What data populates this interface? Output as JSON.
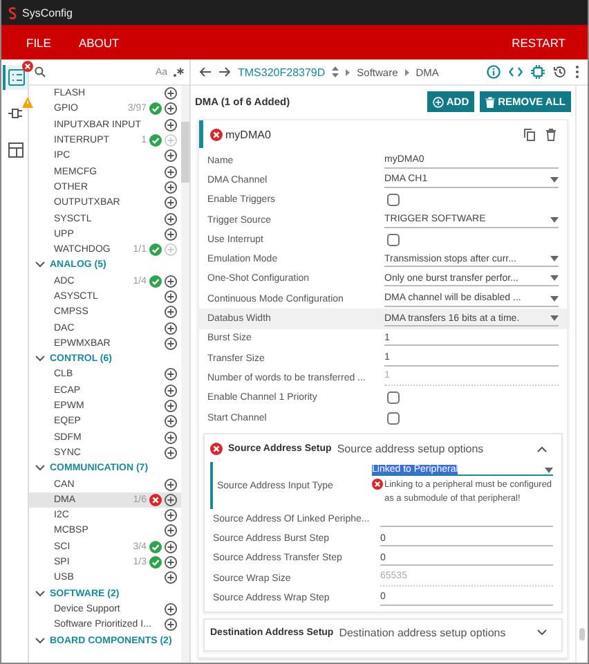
{
  "window": {
    "title": "SysConfig"
  },
  "menu": {
    "items": [
      "FILE",
      "ABOUT"
    ],
    "restart": "RESTART"
  },
  "rail": [
    {
      "kind": "list",
      "error_badge": true,
      "warning_badge": false,
      "selected": true
    },
    {
      "kind": "plug",
      "error_badge": false,
      "warning_badge": true,
      "selected": false
    },
    {
      "kind": "panel",
      "error_badge": false,
      "warning_badge": false,
      "selected": false
    }
  ],
  "sidebar": {
    "case_toggle": "Aa",
    "sections": [
      {
        "items": [
          {
            "label": "FLASH",
            "ok": false,
            "error": false,
            "add_enabled": true,
            "selected": false
          },
          {
            "label": "GPIO",
            "count": "3/97",
            "ok": true,
            "error": false,
            "add_enabled": true,
            "selected": false
          },
          {
            "label": "INPUTXBAR INPUT",
            "ok": false,
            "error": false,
            "add_enabled": true,
            "selected": false
          },
          {
            "label": "INTERRUPT",
            "count": "1",
            "ok": true,
            "error": false,
            "add_enabled": false,
            "selected": false
          },
          {
            "label": "IPC",
            "ok": false,
            "error": false,
            "add_enabled": true,
            "selected": false
          },
          {
            "label": "MEMCFG",
            "ok": false,
            "error": false,
            "add_enabled": true,
            "selected": false
          },
          {
            "label": "OTHER",
            "ok": false,
            "error": false,
            "add_enabled": true,
            "selected": false
          },
          {
            "label": "OUTPUTXBAR",
            "ok": false,
            "error": false,
            "add_enabled": true,
            "selected": false
          },
          {
            "label": "SYSCTL",
            "ok": false,
            "error": false,
            "add_enabled": true,
            "selected": false
          },
          {
            "label": "UPP",
            "ok": false,
            "error": false,
            "add_enabled": true,
            "selected": false
          },
          {
            "label": "WATCHDOG",
            "count": "1/1",
            "ok": true,
            "error": false,
            "add_enabled": false,
            "selected": false
          }
        ]
      },
      {
        "title": "ANALOG (5)",
        "expanded": true,
        "items": [
          {
            "label": "ADC",
            "count": "1/4",
            "ok": true,
            "error": false,
            "add_enabled": true,
            "selected": false
          },
          {
            "label": "ASYSCTL",
            "ok": false,
            "error": false,
            "add_enabled": true,
            "selected": false
          },
          {
            "label": "CMPSS",
            "ok": false,
            "error": false,
            "add_enabled": true,
            "selected": false
          },
          {
            "label": "DAC",
            "ok": false,
            "error": false,
            "add_enabled": true,
            "selected": false
          },
          {
            "label": "EPWMXBAR",
            "ok": false,
            "error": false,
            "add_enabled": true,
            "selected": false
          }
        ]
      },
      {
        "title": "CONTROL (6)",
        "expanded": true,
        "items": [
          {
            "label": "CLB",
            "ok": false,
            "error": false,
            "add_enabled": true,
            "selected": false
          },
          {
            "label": "ECAP",
            "ok": false,
            "error": false,
            "add_enabled": true,
            "selected": false
          },
          {
            "label": "EPWM",
            "ok": false,
            "error": false,
            "add_enabled": true,
            "selected": false
          },
          {
            "label": "EQEP",
            "ok": false,
            "error": false,
            "add_enabled": true,
            "selected": false
          },
          {
            "label": "SDFM",
            "ok": false,
            "error": false,
            "add_enabled": true,
            "selected": false
          },
          {
            "label": "SYNC",
            "ok": false,
            "error": false,
            "add_enabled": true,
            "selected": false
          }
        ]
      },
      {
        "title": "COMMUNICATION (7)",
        "expanded": true,
        "items": [
          {
            "label": "CAN",
            "ok": false,
            "error": false,
            "add_enabled": true,
            "selected": false
          },
          {
            "label": "DMA",
            "count": "1/6",
            "ok": false,
            "error": true,
            "add_enabled": true,
            "selected": true
          },
          {
            "label": "I2C",
            "ok": false,
            "error": false,
            "add_enabled": true,
            "selected": false
          },
          {
            "label": "MCBSP",
            "ok": false,
            "error": false,
            "add_enabled": true,
            "selected": false
          },
          {
            "label": "SCI",
            "count": "3/4",
            "ok": true,
            "error": false,
            "add_enabled": true,
            "selected": false
          },
          {
            "label": "SPI",
            "count": "1/3",
            "ok": true,
            "error": false,
            "add_enabled": true,
            "selected": false
          },
          {
            "label": "USB",
            "ok": false,
            "error": false,
            "add_enabled": true,
            "selected": false
          }
        ]
      },
      {
        "title": "SOFTWARE (2)",
        "expanded": true,
        "items": [
          {
            "label": "Device Support",
            "ok": false,
            "error": false,
            "add_enabled": true,
            "selected": false
          },
          {
            "label": "Software Prioritized I...",
            "ok": false,
            "error": false,
            "add_enabled": true,
            "selected": false
          }
        ]
      },
      {
        "title": "BOARD COMPONENTS (2)",
        "expanded": true
      }
    ]
  },
  "breadcrumb": {
    "device": "TMS320F28379D",
    "path": [
      "Software",
      "DMA"
    ]
  },
  "module": {
    "title": "DMA (1 of 6 Added)",
    "add": "ADD",
    "remove_all": "REMOVE ALL"
  },
  "instance": {
    "name": "myDMA0",
    "error": true,
    "fields": [
      {
        "label": "Name",
        "kind": "text",
        "value": "myDMA0",
        "highlighted": false
      },
      {
        "label": "DMA Channel",
        "kind": "select",
        "value": "DMA CH1",
        "highlighted": false
      },
      {
        "label": "Enable Triggers",
        "kind": "checkbox",
        "checked": false,
        "highlighted": false
      },
      {
        "label": "Trigger Source",
        "kind": "select",
        "value": "TRIGGER SOFTWARE",
        "highlighted": false
      },
      {
        "label": "Use Interrupt",
        "kind": "checkbox",
        "checked": false,
        "highlighted": false
      },
      {
        "label": "Emulation Mode",
        "kind": "select",
        "value": "Transmission stops after curr...",
        "highlighted": false
      },
      {
        "label": "One-Shot Configuration",
        "kind": "select",
        "value": "Only one burst transfer perfor...",
        "highlighted": false
      },
      {
        "label": "Continuous Mode Configuration",
        "kind": "select",
        "value": "DMA channel will be disabled ...",
        "highlighted": false
      },
      {
        "label": "Databus Width",
        "kind": "select",
        "value": "DMA transfers 16 bits at a time.",
        "highlighted": true
      },
      {
        "label": "Burst Size",
        "kind": "text",
        "value": "1",
        "highlighted": false
      },
      {
        "label": "Transfer Size",
        "kind": "text",
        "value": "1",
        "highlighted": false
      },
      {
        "label": "Number of words to be transferred ...",
        "kind": "readonly",
        "value": "1",
        "highlighted": false
      },
      {
        "label": "Enable Channel 1 Priority",
        "kind": "checkbox",
        "checked": false,
        "highlighted": false
      },
      {
        "label": "Start Channel",
        "kind": "checkbox",
        "checked": false,
        "highlighted": false
      }
    ],
    "groups": [
      {
        "title": "Source Address Setup",
        "description": "Source address setup options",
        "error": true,
        "expanded": true,
        "fields": [
          {
            "label": "Source Address Input Type",
            "kind": "select",
            "value": "Linked to Peripheral",
            "error": "Linking to a peripheral must be configured as a submodule of that peripheral!"
          },
          {
            "label": "Source Address Of Linked Periphe...",
            "kind": "text",
            "highlighted": false
          },
          {
            "label": "Source Address Burst Step",
            "kind": "text",
            "value": "0",
            "highlighted": false
          },
          {
            "label": "Source Address Transfer Step",
            "kind": "text",
            "value": "0",
            "highlighted": false
          },
          {
            "label": "Source Wrap Size",
            "kind": "readonly",
            "value": "65535",
            "highlighted": false
          },
          {
            "label": "Source Address Wrap Step",
            "kind": "text",
            "value": "0",
            "highlighted": false
          }
        ]
      },
      {
        "title": "Destination Address Setup",
        "description": "Destination address setup options",
        "error": false,
        "expanded": false
      }
    ]
  }
}
